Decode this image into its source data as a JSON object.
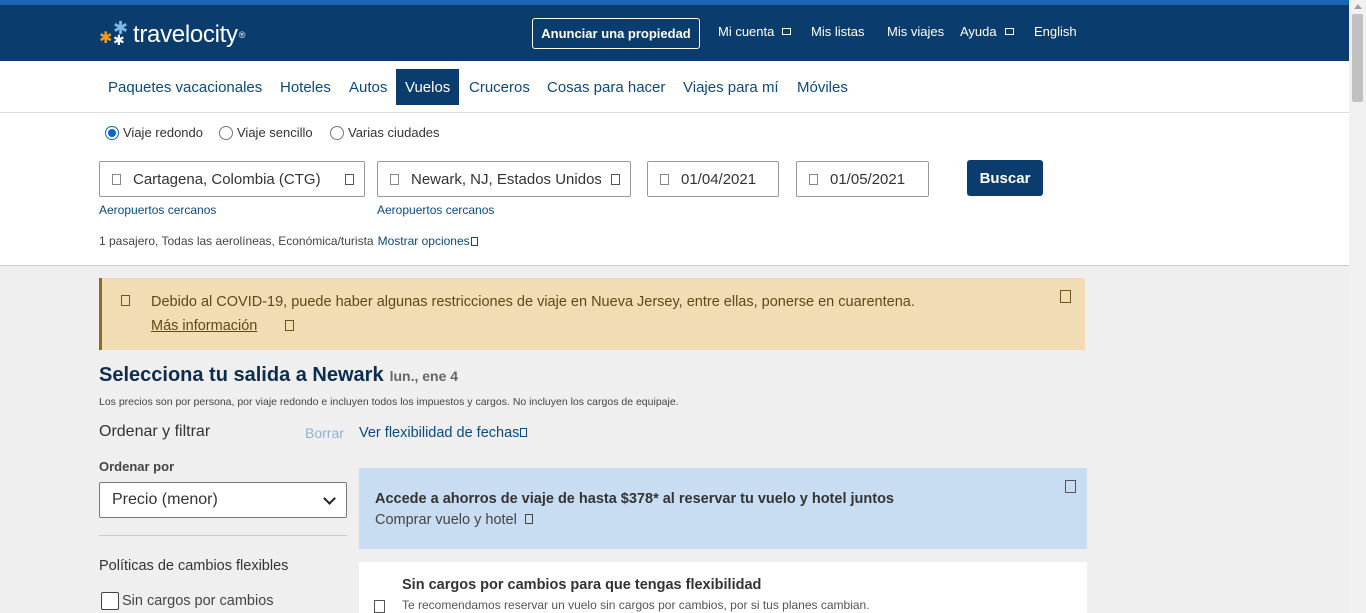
{
  "header": {
    "logo_text": "travelocity",
    "logo_tm": "®",
    "list_property": "Anunciar una propiedad",
    "nav": [
      "Mi cuenta",
      "Mis listas",
      "Mis viajes",
      "Ayuda",
      "English"
    ]
  },
  "tabs": [
    "Paquetes vacacionales",
    "Hoteles",
    "Autos",
    "Vuelos",
    "Cruceros",
    "Cosas para hacer",
    "Viajes para mí",
    "Móviles"
  ],
  "search": {
    "trip_types": [
      "Viaje redondo",
      "Viaje sencillo",
      "Varias ciudades"
    ],
    "selected_trip_type": "Viaje redondo",
    "origin": "Cartagena, Colombia (CTG)",
    "destination": "Newark, NJ, Estados Unidos",
    "depart_date": "01/04/2021",
    "return_date": "01/05/2021",
    "nearby_origin": "Aeropuertos cercanos",
    "nearby_destination": "Aeropuertos cercanos",
    "search_button": "Buscar",
    "passenger_summary": "1 pasajero, Todas las aerolíneas, Económica/turista",
    "show_options": "Mostrar opciones"
  },
  "alert": {
    "message": "Debido al COVID-19, puede haber algunas restricciones de viaje en Nueva Jersey, entre ellas, ponerse en cuarentena.",
    "more_info": "Más información"
  },
  "results": {
    "heading": "Selecciona tu salida a Newark",
    "date": "lun., ene 4",
    "disclaimer": "Los precios son por persona, por viaje redondo e incluyen todos los impuestos y cargos. No incluyen los cargos de equipaje.",
    "sort_filter": "Ordenar y filtrar",
    "clear": "Borrar",
    "flex_dates": "Ver flexibilidad de fechas",
    "sort_by_label": "Ordenar por",
    "sort_by_value": "Precio (menor)",
    "flex_policies": "Políticas de cambios flexibles",
    "no_change_fees": "Sin cargos por cambios"
  },
  "promo": {
    "title": "Accede a ahorros de viaje de hasta $378* al reservar tu vuelo y hotel juntos",
    "subtitle": "Comprar vuelo y hotel"
  },
  "card": {
    "title": "Sin cargos por cambios para que tengas flexibilidad",
    "subtitle": "Te recomendamos reservar un vuelo sin cargos por cambios, por si tus planes cambian."
  },
  "colors": {
    "brand_navy": "#0a3d6e",
    "link_blue": "#0a4a82",
    "alert_bg": "#f1dcb4",
    "promo_bg": "#c9ddf2"
  }
}
